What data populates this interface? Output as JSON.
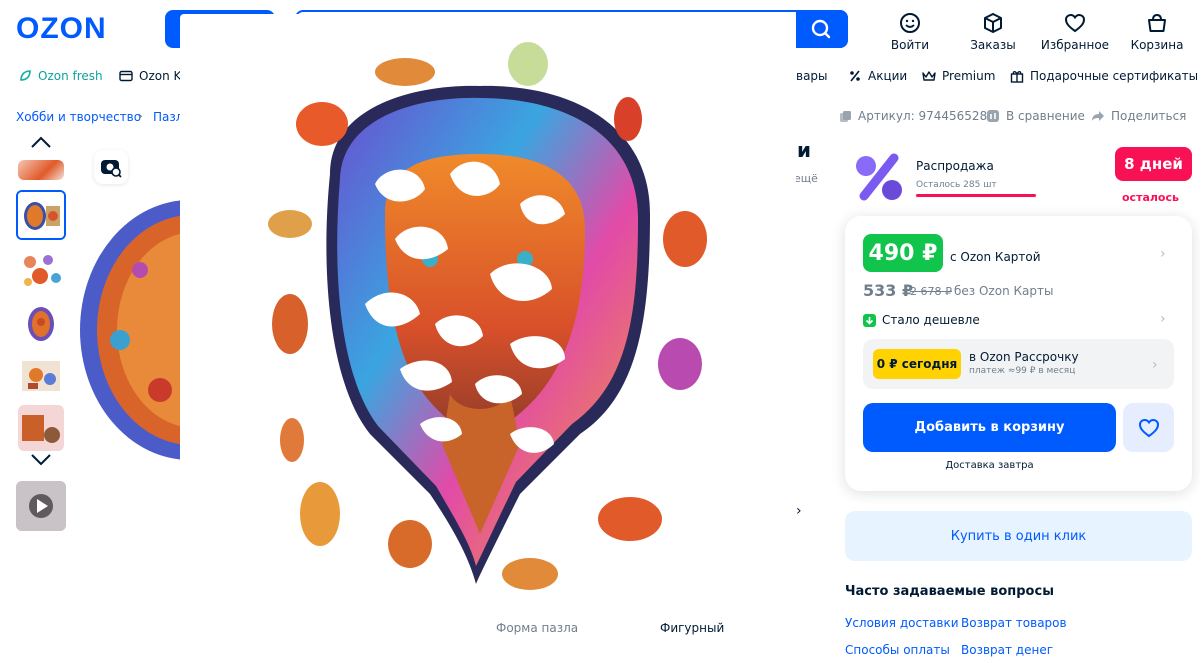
{
  "header": {
    "logo": "OZON",
    "icons": [
      {
        "label": "Войти",
        "icon": "smile-icon"
      },
      {
        "label": "Заказы",
        "icon": "box-icon"
      },
      {
        "label": "Избранное",
        "icon": "heart-icon"
      },
      {
        "label": "Корзина",
        "icon": "cart-icon"
      }
    ]
  },
  "nav": {
    "fresh": "Ozon fresh",
    "card": "Ozon Ka",
    "goods_tail": "вары",
    "actions": "Акции",
    "premium": "Premium",
    "gift": "Подарочные сертификаты"
  },
  "breadcrumb": {
    "first": "Хобби и творчество",
    "second": "Пазл"
  },
  "meta": {
    "article": "Артикул: 974456528",
    "compare": "В сравнение",
    "share": "Поделиться"
  },
  "title_fragment": "и",
  "title_sub_fragment": "ещё",
  "sale": {
    "label": "Распродажа",
    "remaining": "Осталось 285 шт",
    "days": "8 дней",
    "days_left": "осталось"
  },
  "price": {
    "card_price": "490 ₽",
    "with_card": "с Ozon Картой",
    "price": "533 ₽",
    "old_price": "2 678 ₽",
    "without_card": "без Ozon Карты",
    "cheaper": "Стало дешевле"
  },
  "installment": {
    "badge": "0 ₽ сегодня",
    "title": "в Ozon Рассрочку",
    "sub": "платеж ≈99 ₽ в месяц"
  },
  "actions": {
    "add_to_cart": "Добавить в корзину",
    "delivery": "Доставка завтра",
    "one_click": "Купить в один клик"
  },
  "faq": {
    "title": "Часто задаваемые вопросы",
    "links": [
      "Условия доставки",
      "Возврат товаров"
    ],
    "links_cut": [
      "Способы оплаты",
      "Возврат денег"
    ]
  },
  "specs": {
    "row_label": "Форма пазла",
    "row_value": "Фигурный"
  },
  "colors": {
    "accent": "#005bff",
    "sale": "#f91155",
    "price_green": "#10c44c",
    "installment_yellow": "#ffd200"
  }
}
